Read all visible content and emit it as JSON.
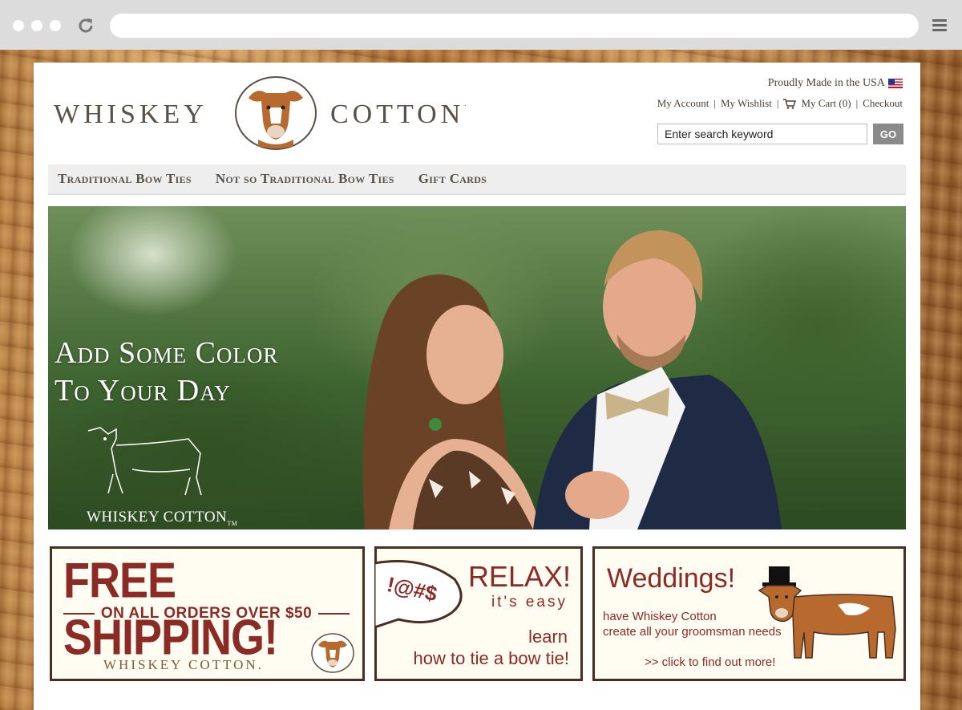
{
  "brand": {
    "name_left": "WHISKEY",
    "name_right": "COTTON",
    "trademark": ".",
    "colors": {
      "accent": "#8c2a26",
      "text": "#5a5149",
      "border": "#4a2e22"
    }
  },
  "header": {
    "made_in": "Proudly Made in the USA",
    "links": {
      "my_account": "My Account",
      "my_wishlist": "My Wishlist",
      "my_cart": "My Cart (0)",
      "checkout": "Checkout",
      "separator": "|"
    },
    "search": {
      "placeholder": "Enter search keyword",
      "value": "Enter search keyword",
      "button": "GO"
    }
  },
  "nav": {
    "items": [
      {
        "label": "Traditional Bow Ties"
      },
      {
        "label": "Not so Traditional Bow Ties"
      },
      {
        "label": "Gift Cards"
      }
    ]
  },
  "hero": {
    "line1": "Add Some Color",
    "line2": "To Your Day",
    "brand": "WHISKEY COTTON",
    "tm": "TM"
  },
  "promos": {
    "shipping": {
      "title": "FREE SHIPPING!",
      "subtitle": "ON ALL ORDERS OVER $50",
      "brand": "WHISKEY COTTON."
    },
    "relax": {
      "bubble": "!@#$",
      "title": "RELAX!",
      "subtitle": "it's easy",
      "learn": "learn",
      "how": "how to tie a bow tie!"
    },
    "weddings": {
      "title": "Weddings!",
      "line1": "have Whiskey Cotton",
      "line2": "create all your groomsman needs",
      "cta": ">> click to find out more!"
    }
  }
}
